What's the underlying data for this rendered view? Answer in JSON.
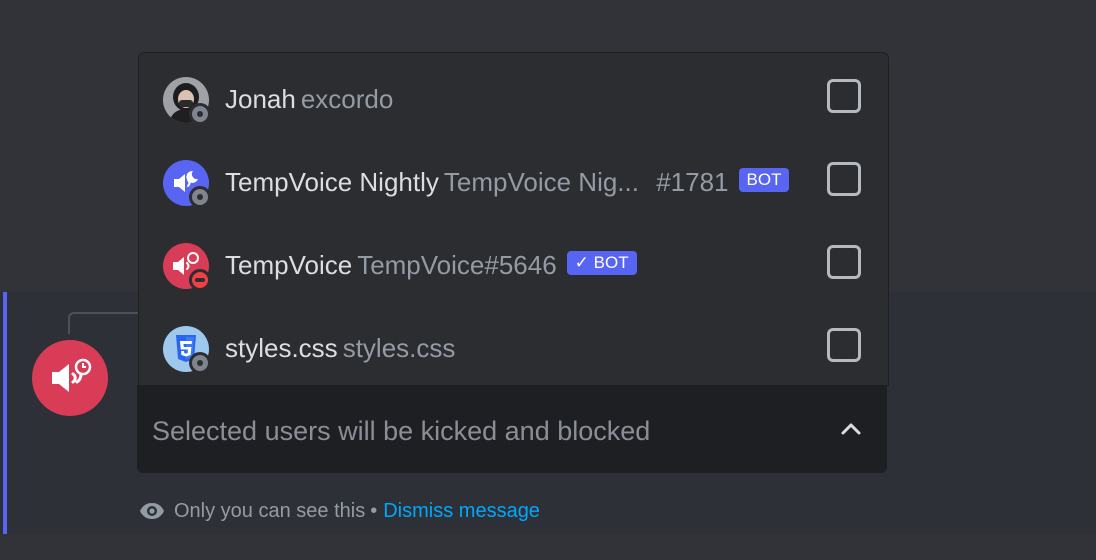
{
  "message": {
    "accent_color": "#5865f2",
    "avatar_icon": "tempvoice-speaker-icon",
    "avatar_color": "#d83c57"
  },
  "dropdown": {
    "options": [
      {
        "name": "Jonah",
        "sub": "excordo",
        "status": "offline",
        "avatar": "user-photo-avatar"
      },
      {
        "name": "TempVoice Nightly",
        "sub": "TempVoice Nig...",
        "discriminator": "#1781",
        "badge": "BOT",
        "status": "offline",
        "avatar": "tempvoice-nightly-icon"
      },
      {
        "name": "TempVoice",
        "sub": "TempVoice#5646",
        "badge": "✓ BOT",
        "status": "dnd",
        "avatar": "tempvoice-icon"
      },
      {
        "name": "styles.css",
        "sub": "styles.css",
        "status": "offline",
        "avatar": "css3-icon"
      }
    ]
  },
  "select": {
    "placeholder": "Selected users will be kicked and blocked",
    "chevron": "chevron-up-icon"
  },
  "ephemeral": {
    "notice": "Only you can see this",
    "separator": "•",
    "dismiss_label": "Dismiss message"
  }
}
